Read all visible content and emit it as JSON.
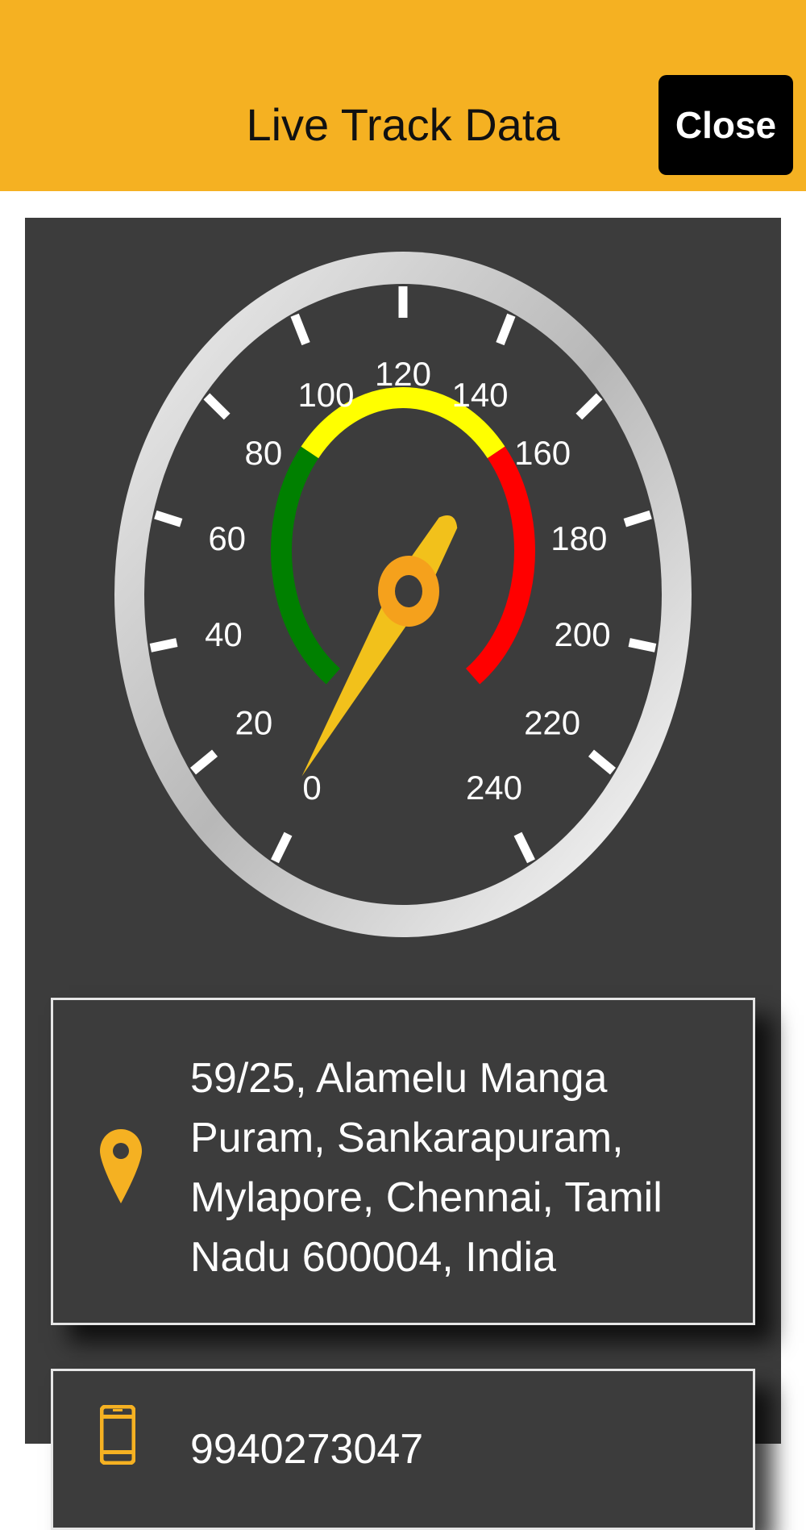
{
  "header": {
    "title": "Live Track Data",
    "close_label": "Close",
    "background_color": "#F5B122"
  },
  "speedometer": {
    "scale_labels": [
      "0",
      "20",
      "40",
      "60",
      "80",
      "100",
      "120",
      "140",
      "160",
      "180",
      "200",
      "220",
      "240"
    ],
    "min": 0,
    "max": 240,
    "current_speed": 0,
    "zones": [
      {
        "name": "green",
        "color": "#008000"
      },
      {
        "name": "yellow",
        "color": "#FFFF00"
      },
      {
        "name": "red",
        "color": "#FF0000"
      }
    ],
    "needle_color": "#F2C11B",
    "hub_color": "#F5A11C"
  },
  "location": {
    "icon": "map-pin-icon",
    "address": "59/25, Alamelu Manga Puram, Sankarapuram, Mylapore, Chennai, Tamil Nadu 600004, India"
  },
  "phone": {
    "icon": "mobile-phone-icon",
    "number": "9940273047"
  }
}
